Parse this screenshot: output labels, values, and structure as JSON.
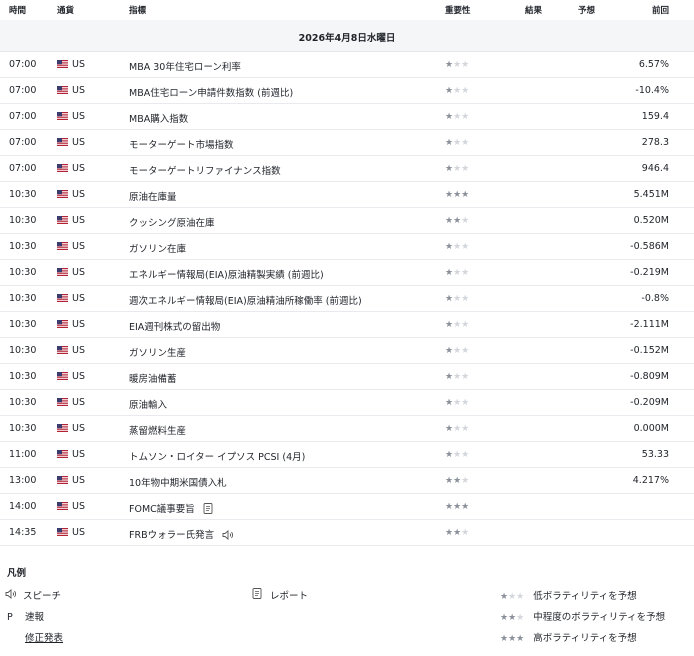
{
  "header": {
    "time": "時間",
    "currency": "通貨",
    "indicator": "指標",
    "importance": "重要性",
    "actual": "結果",
    "forecast": "予想",
    "previous": "前回"
  },
  "date_label": "2026年4月8日水曜日",
  "events": [
    {
      "time": "07:00",
      "currency": "US",
      "name": "MBA 30年住宅ローン利率",
      "stars": 1,
      "previous": "6.57%",
      "icon": ""
    },
    {
      "time": "07:00",
      "currency": "US",
      "name": "MBA住宅ローン申請件数指数 (前週比)",
      "stars": 1,
      "previous": "-10.4%",
      "icon": ""
    },
    {
      "time": "07:00",
      "currency": "US",
      "name": "MBA購入指数",
      "stars": 1,
      "previous": "159.4",
      "icon": ""
    },
    {
      "time": "07:00",
      "currency": "US",
      "name": "モーターゲート市場指数",
      "stars": 1,
      "previous": "278.3",
      "icon": ""
    },
    {
      "time": "07:00",
      "currency": "US",
      "name": "モーターゲートリファイナンス指数",
      "stars": 1,
      "previous": "946.4",
      "icon": ""
    },
    {
      "time": "10:30",
      "currency": "US",
      "name": "原油在庫量",
      "stars": 3,
      "previous": "5.451M",
      "icon": ""
    },
    {
      "time": "10:30",
      "currency": "US",
      "name": "クッシング原油在庫",
      "stars": 2,
      "previous": "0.520M",
      "icon": ""
    },
    {
      "time": "10:30",
      "currency": "US",
      "name": "ガソリン在庫",
      "stars": 1,
      "previous": "-0.586M",
      "icon": ""
    },
    {
      "time": "10:30",
      "currency": "US",
      "name": "エネルギー情報局(EIA)原油精製実績 (前週比)",
      "stars": 1,
      "previous": "-0.219M",
      "icon": ""
    },
    {
      "time": "10:30",
      "currency": "US",
      "name": "週次エネルギー情報局(EIA)原油精油所稼働率 (前週比)",
      "stars": 1,
      "previous": "-0.8%",
      "icon": ""
    },
    {
      "time": "10:30",
      "currency": "US",
      "name": "EIA週刊株式の留出物",
      "stars": 1,
      "previous": "-2.111M",
      "icon": ""
    },
    {
      "time": "10:30",
      "currency": "US",
      "name": "ガソリン生産",
      "stars": 1,
      "previous": "-0.152M",
      "icon": ""
    },
    {
      "time": "10:30",
      "currency": "US",
      "name": "暖房油備蓄",
      "stars": 1,
      "previous": "-0.809M",
      "icon": ""
    },
    {
      "time": "10:30",
      "currency": "US",
      "name": "原油輸入",
      "stars": 1,
      "previous": "-0.209M",
      "icon": ""
    },
    {
      "time": "10:30",
      "currency": "US",
      "name": "蒸留燃料生産",
      "stars": 1,
      "previous": "0.000M",
      "icon": ""
    },
    {
      "time": "11:00",
      "currency": "US",
      "name": "トムソン・ロイター イプソス PCSI (4月)",
      "stars": 1,
      "previous": "53.33",
      "icon": ""
    },
    {
      "time": "13:00",
      "currency": "US",
      "name": "10年物中期米国債入札",
      "stars": 2,
      "previous": "4.217%",
      "icon": ""
    },
    {
      "time": "14:00",
      "currency": "US",
      "name": "FOMC議事要旨",
      "stars": 3,
      "previous": "",
      "icon": "report-icon"
    },
    {
      "time": "14:35",
      "currency": "US",
      "name": "FRBウォラー氏発言",
      "stars": 2,
      "previous": "",
      "icon": "speech-icon"
    }
  ],
  "legend": {
    "title": "凡例",
    "speech": "スピーチ",
    "report": "レポート",
    "preliminary_symbol": "P",
    "preliminary": "速報",
    "revised": "修正発表",
    "low_vol": "低ボラティリティを予想",
    "mid_vol": "中程度のボラティリティを予想",
    "high_vol": "高ボラティリティを予想"
  },
  "colors": {
    "star_on": "#8a9099",
    "star_off": "#d3d6da",
    "flag_red": "#b22234",
    "flag_blue": "#3c3b6e",
    "row_border": "#e8eaed",
    "date_bg": "#f5f6f7"
  }
}
